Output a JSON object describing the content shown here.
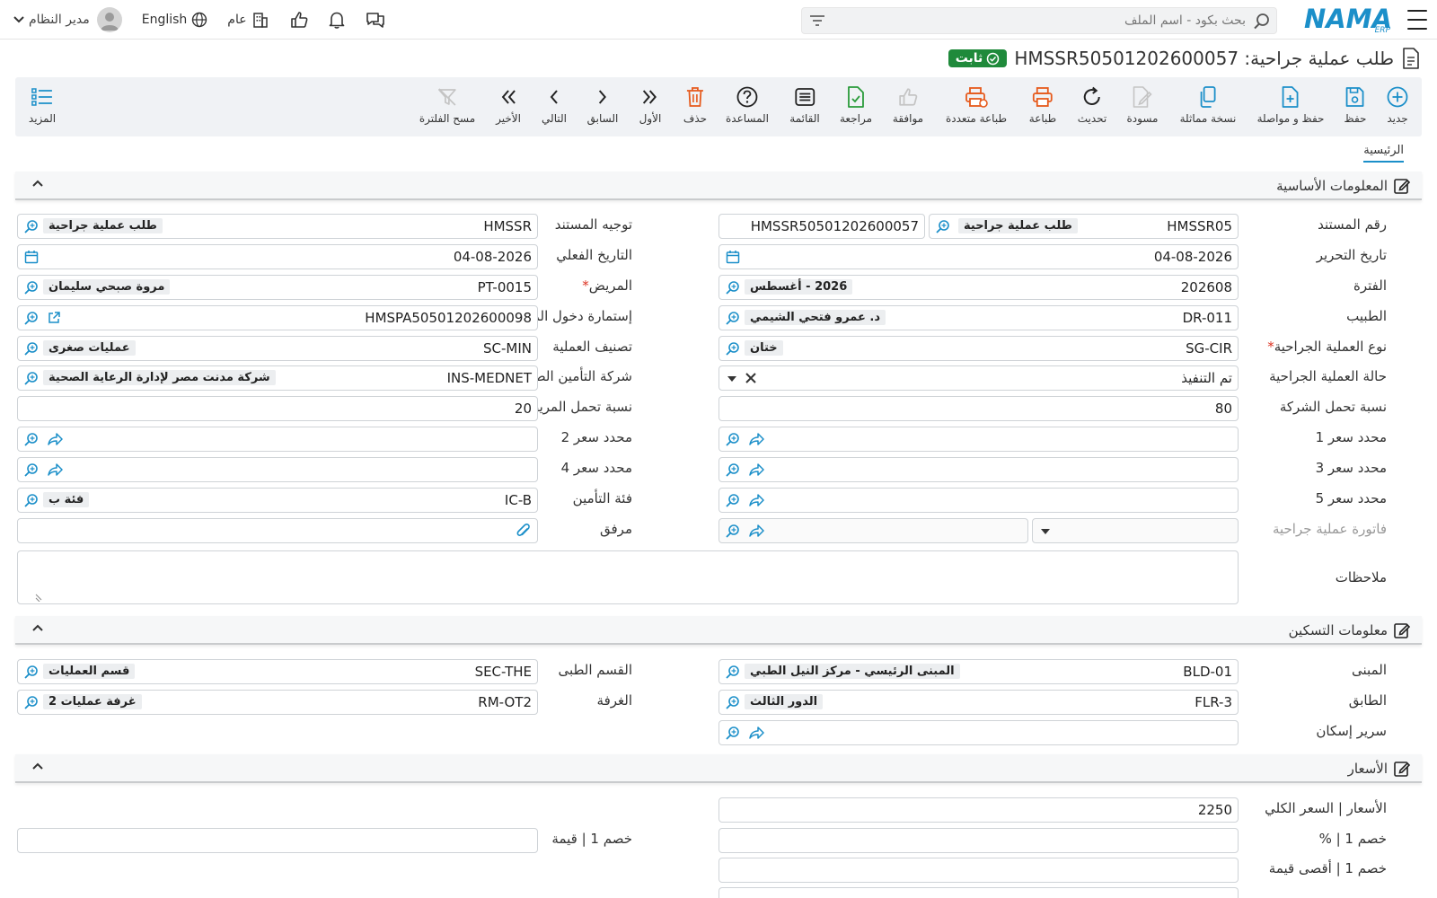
{
  "topbar": {
    "logo": "NAMA",
    "logo_sub": "ERP",
    "search_placeholder": "بحث بكود - اسم الملف",
    "user_name": "مدير النظام",
    "language": "English",
    "scope": "عام"
  },
  "title": {
    "text": "طلب عملية جراحية: HMSSR50501202600057",
    "status": "ثابت"
  },
  "toolbar": {
    "new": "جديد",
    "save": "حفظ",
    "save_continue": "حفظ و مواصلة",
    "duplicate": "نسخة مماثلة",
    "draft": "مسودة",
    "refresh": "تحديث",
    "print": "طباعة",
    "multi_print": "طباعة متعددة",
    "approve": "موافقة",
    "review": "مراجعة",
    "list": "القائمة",
    "help": "المساعدة",
    "delete": "حذف",
    "first": "الأول",
    "previous": "السابق",
    "next": "التالي",
    "last": "الأخير",
    "clear_filter": "مسح الفلترة",
    "more": "المزيد"
  },
  "tabs": {
    "main": "الرئيسية"
  },
  "sections": {
    "basic": "المعلومات الأساسية",
    "housing": "معلومات التسكين",
    "prices": "الأسعار"
  },
  "form": {
    "doc_no_label": "رقم المستند",
    "doc_no_code": "HMSSR05",
    "doc_no_name": "طلب عملية جراحية",
    "doc_no_full": "HMSSR50501202600057",
    "doc_route_label": "توجيه المستند",
    "doc_route_code": "HMSSR",
    "doc_route_name": "طلب عملية جراحية",
    "edit_date_label": "تاريخ التحرير",
    "edit_date": "04-08-2026",
    "actual_date_label": "التاريخ الفعلي",
    "actual_date": "04-08-2026",
    "period_label": "الفترة",
    "period_code": "202608",
    "period_name": "2026 - أغسطس",
    "patient_label": "المريض",
    "patient_code": "PT-0015",
    "patient_name": "مروة صبحي سليمان",
    "doctor_label": "الطبيب",
    "doctor_code": "DR-011",
    "doctor_name": "د. عمرو فتحي الشيمي",
    "admission_label": "إستمارة دخول المريض",
    "admission_code": "HMSPA50501202600098",
    "surgery_type_label": "نوع العملية الجراحية",
    "surgery_type_code": "SG-CIR",
    "surgery_type_name": "ختان",
    "op_class_label": "تصنيف العملية",
    "op_class_code": "SC-MIN",
    "op_class_name": "عمليات صغرى",
    "surgery_status_label": "حالة العملية الجراحية",
    "surgery_status": "تم التنفيذ",
    "insurance_label": "شركة التأمين الطبى",
    "insurance_code": "INS-MEDNET",
    "insurance_name": "شركة مدنت مصر لإدارة الرعاية الصحية",
    "company_share_label": "نسبة تحمل الشركة",
    "company_share": "80",
    "patient_share_label": "نسبة تحمل المريض",
    "patient_share": "20",
    "price1_label": "محدد سعر 1",
    "price2_label": "محدد سعر 2",
    "price3_label": "محدد سعر 3",
    "price4_label": "محدد سعر 4",
    "price5_label": "محدد سعر 5",
    "ins_category_label": "فئة التأمين",
    "ins_category_code": "IC-B",
    "ins_category_name": "فئة ب",
    "invoice_label": "فاتورة عملية جراحية",
    "attachment_label": "مرفق",
    "notes_label": "ملاحظات"
  },
  "housing": {
    "building_label": "المبنى",
    "building_code": "BLD-01",
    "building_name": "المبنى الرئيسي - مركز النيل الطبي",
    "department_label": "القسم الطبى",
    "department_code": "SEC-THE",
    "department_name": "قسم العمليات",
    "floor_label": "الطابق",
    "floor_code": "FLR-3",
    "floor_name": "الدور الثالث",
    "room_label": "الغرفة",
    "room_code": "RM-OT2",
    "room_name": "غرفة عمليات 2",
    "bed_label": "سرير إسكان"
  },
  "prices": {
    "total_label": "الأسعار | السعر الكلي",
    "total": "2250",
    "disc1_pct_label": "خصم 1 | %",
    "disc1_value_label": "خصم 1 | قيمة",
    "disc1_max_label": "خصم 1 | أقصى قيمة"
  }
}
